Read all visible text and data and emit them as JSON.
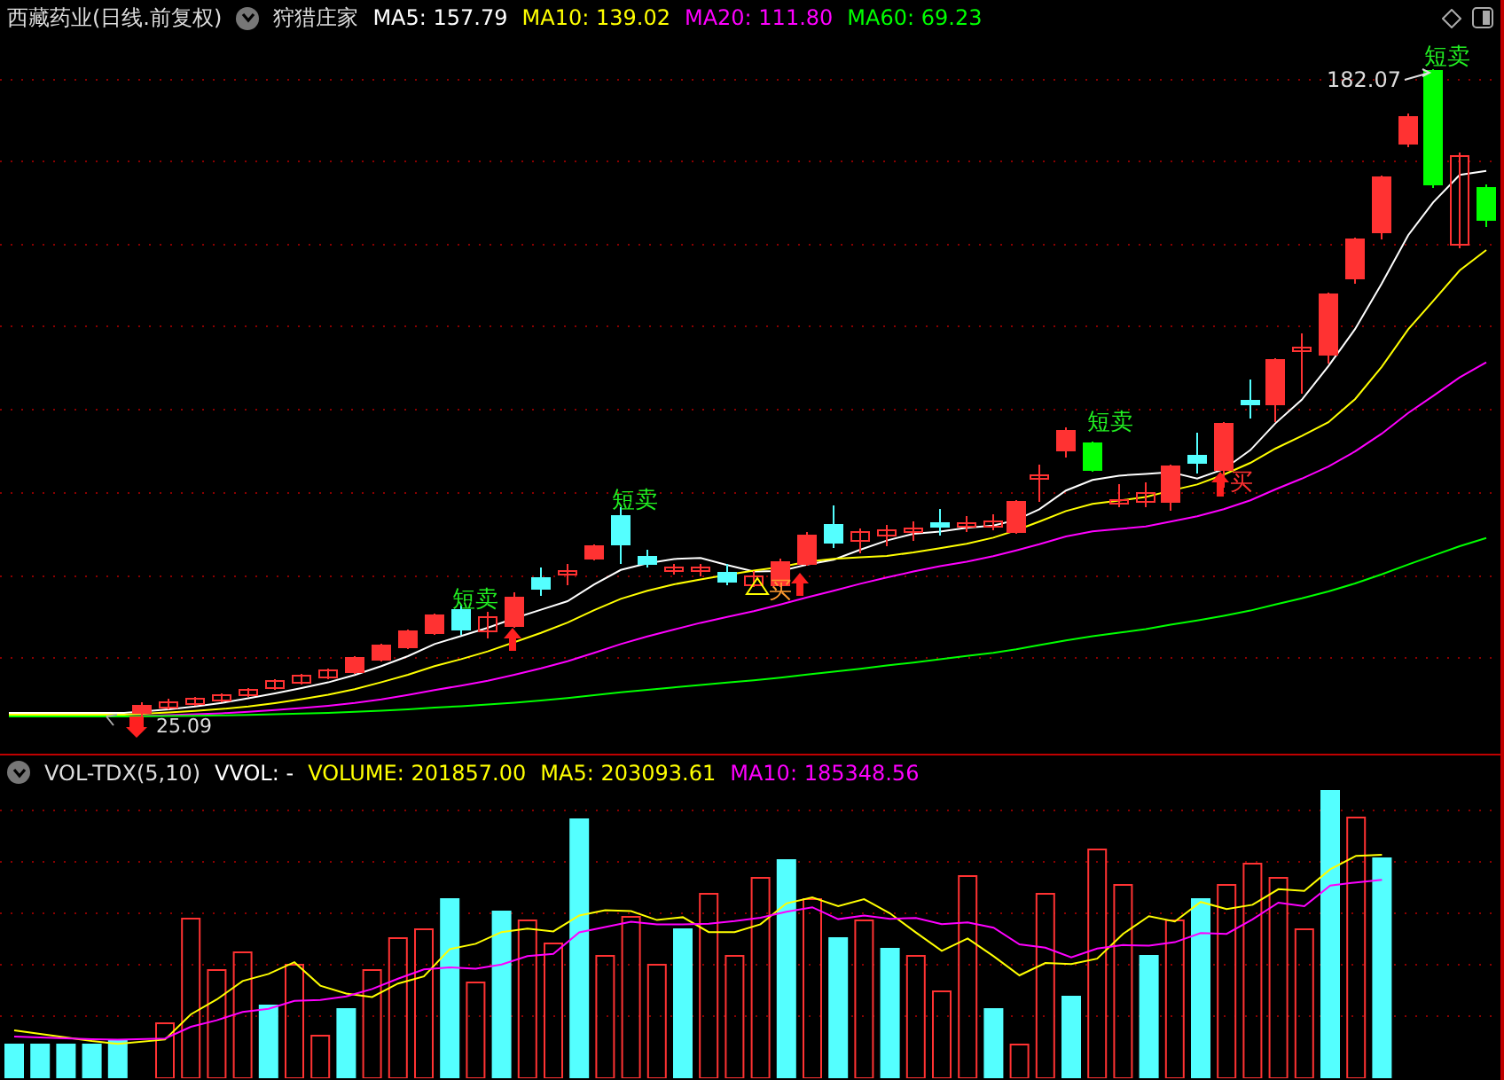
{
  "header": {
    "title": "西藏药业(日线.前复权)",
    "indicator": "狩猎庄家",
    "averages": [
      {
        "label": "MA5:",
        "value": "157.79",
        "color": "#ffffff"
      },
      {
        "label": "MA10:",
        "value": "139.02",
        "color": "#ffff00"
      },
      {
        "label": "MA20:",
        "value": "111.80",
        "color": "#ff00ff"
      },
      {
        "label": "MA60:",
        "value": "69.23",
        "color": "#00ff00"
      }
    ]
  },
  "price_chart": {
    "high_label": "182.07",
    "low_label": "25.09",
    "signals": [
      {
        "kind": "sell",
        "text": "短卖"
      },
      {
        "kind": "sell",
        "text": "短卖"
      },
      {
        "kind": "buy",
        "text": "买"
      },
      {
        "kind": "sell",
        "text": "短卖"
      },
      {
        "kind": "buy",
        "text": "买"
      },
      {
        "kind": "sell",
        "text": "短卖"
      }
    ]
  },
  "volume_panel": {
    "indicator": "VOL-TDX(5,10)",
    "items": [
      {
        "label": "VVOL:",
        "value": "-",
        "color": "#ffffff"
      },
      {
        "label": "VOLUME:",
        "value": "201857.00",
        "color": "#ffff00"
      },
      {
        "label": "MA5:",
        "value": "203093.61",
        "color": "#ffff00"
      },
      {
        "label": "MA10:",
        "value": "185348.56",
        "color": "#ff00ff"
      }
    ]
  }
}
